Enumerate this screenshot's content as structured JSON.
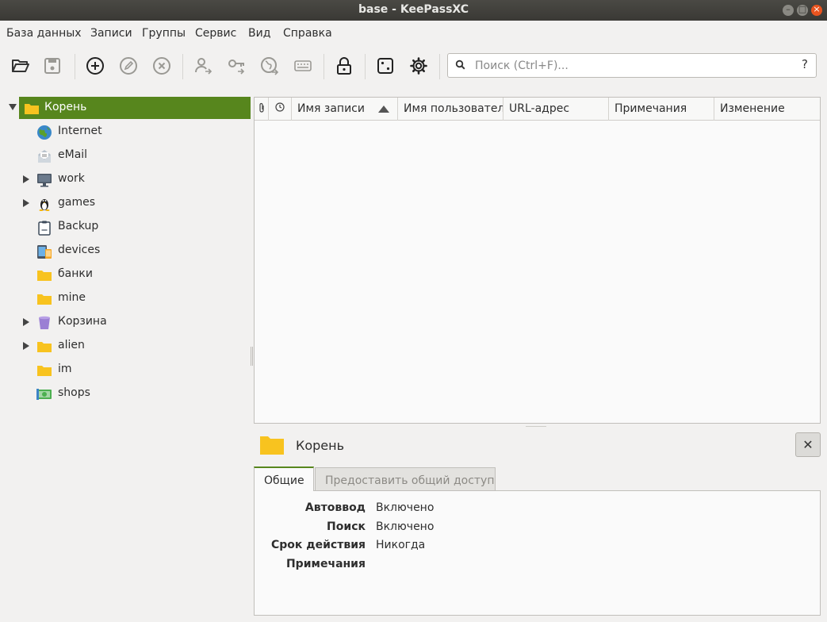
{
  "window": {
    "title": "base - KeePassXC"
  },
  "menu": [
    "База данных",
    "Записи",
    "Группы",
    "Сервис",
    "Вид",
    "Справка"
  ],
  "toolbar": {
    "search_placeholder": "Поиск (Ctrl+F)...",
    "help_label": "?"
  },
  "tree": {
    "root": "Корень",
    "groups": [
      "Internet",
      "eMail",
      "work",
      "games",
      "Backup",
      "devices",
      "банки",
      "mine",
      "Корзина",
      "alien",
      "im",
      "shops"
    ]
  },
  "entries": {
    "columns": [
      "Имя записи",
      "Имя пользователя",
      "URL-адрес",
      "Примечания",
      "Изменение"
    ]
  },
  "details": {
    "title": "Корень",
    "close_label": "✕",
    "tabs": [
      "Общие",
      "Предоставить общий доступ"
    ],
    "properties": [
      {
        "label": "Автоввод",
        "value": "Включено"
      },
      {
        "label": "Поиск",
        "value": "Включено"
      },
      {
        "label": "Срок действия",
        "value": "Никогда"
      },
      {
        "label": "Примечания",
        "value": ""
      }
    ]
  },
  "colors": {
    "accent": "#57861d",
    "folder": "#f8c31f",
    "close": "#e9541f"
  }
}
